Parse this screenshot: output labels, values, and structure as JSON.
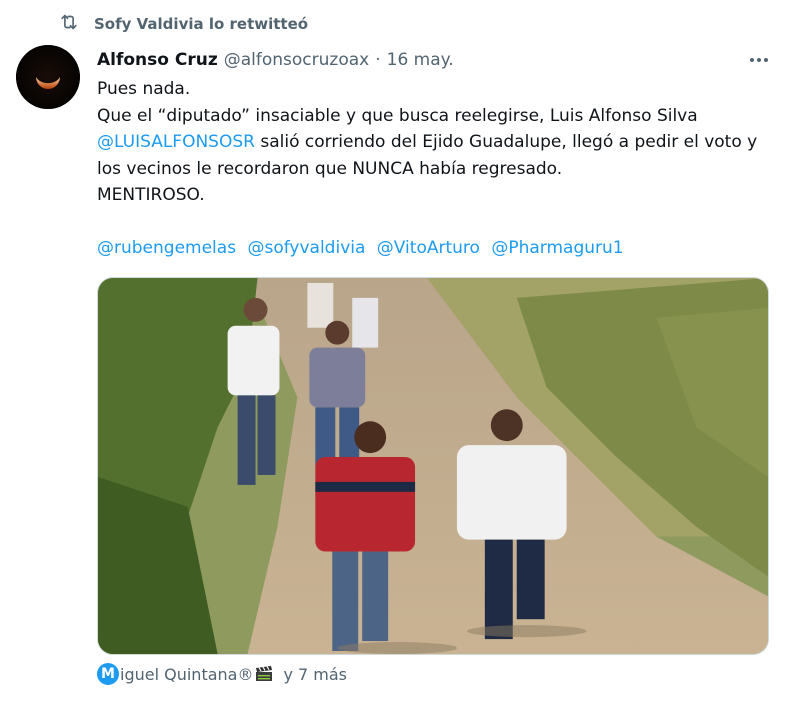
{
  "retweet": {
    "icon": "retweet-icon",
    "text": "Sofy Valdivia lo retwitteó"
  },
  "tweet": {
    "author_name": "Alfonso Cruz",
    "author_handle": "@alfonsocruzoax",
    "separator": "·",
    "date": "16 may.",
    "more_icon": "more-icon",
    "body_line1": "Pues nada.",
    "body_p2_before": "Que el “diputado” insaciable y que busca reelegirse, Luis Alfonso Silva ",
    "body_p2_mention": "@LUISALFONSOSR",
    "body_p2_after": " salió corriendo del Ejido Guadalupe, llegó a pedir el voto y los vecinos le recordaron que NUNCA había regresado.",
    "body_line3": "MENTIROSO.",
    "mentions": [
      "@rubengemelas",
      "@sofyvaldivia",
      "@VitoArturo",
      "@Pharmaguru1"
    ],
    "media": {
      "description_icon": "photo-of-men-running-on-dirt-road"
    },
    "tagged": {
      "badge": "M",
      "name": "iguel Quintana®",
      "emoji_icon": "clapperboard-icon",
      "more": "y 7 más"
    }
  },
  "colors": {
    "accent": "#1d9bf0",
    "muted": "#536471",
    "text": "#0f1419",
    "border": "#cfd9de"
  }
}
